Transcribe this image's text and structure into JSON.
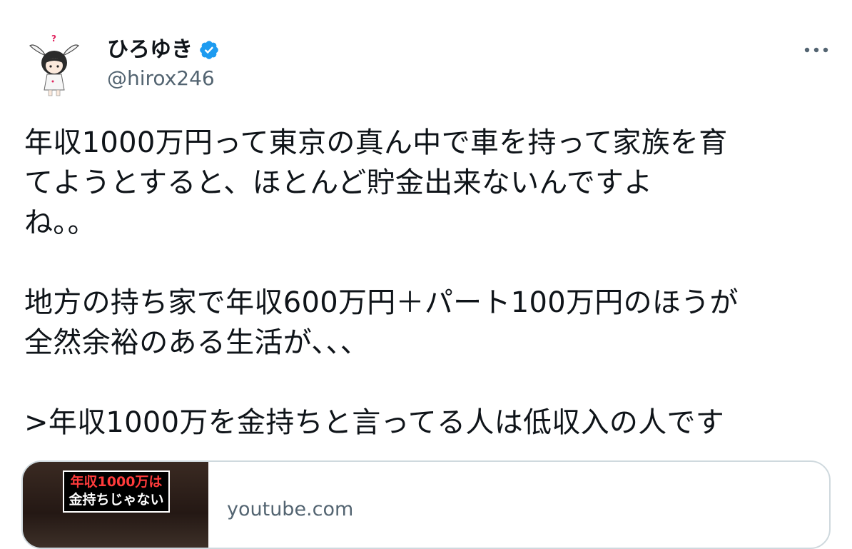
{
  "author": {
    "name": "ひろゆき",
    "handle": "@hirox246",
    "verified": true,
    "verified_color": "#1d9bf0"
  },
  "more_icon": "more-horizontal-icon",
  "tweet": {
    "paragraphs": [
      {
        "lines": [
          "年収1000万円って東京の真ん中で車を持って家族を育",
          "てようとすると、ほとんど貯金出来ないんですよ",
          "ね。。"
        ]
      },
      {
        "lines": [
          "地方の持ち家で年収600万円＋パート100万円のほうが",
          "全然余裕のある生活が、、、"
        ]
      },
      {
        "lines": [
          ">年収1000万を金持ちと言ってる人は低収入の人です"
        ]
      }
    ]
  },
  "card": {
    "domain": "youtube.com",
    "thumbnail_caption_line1": "年収1000万は",
    "thumbnail_caption_line2": "金持ちじゃない"
  }
}
